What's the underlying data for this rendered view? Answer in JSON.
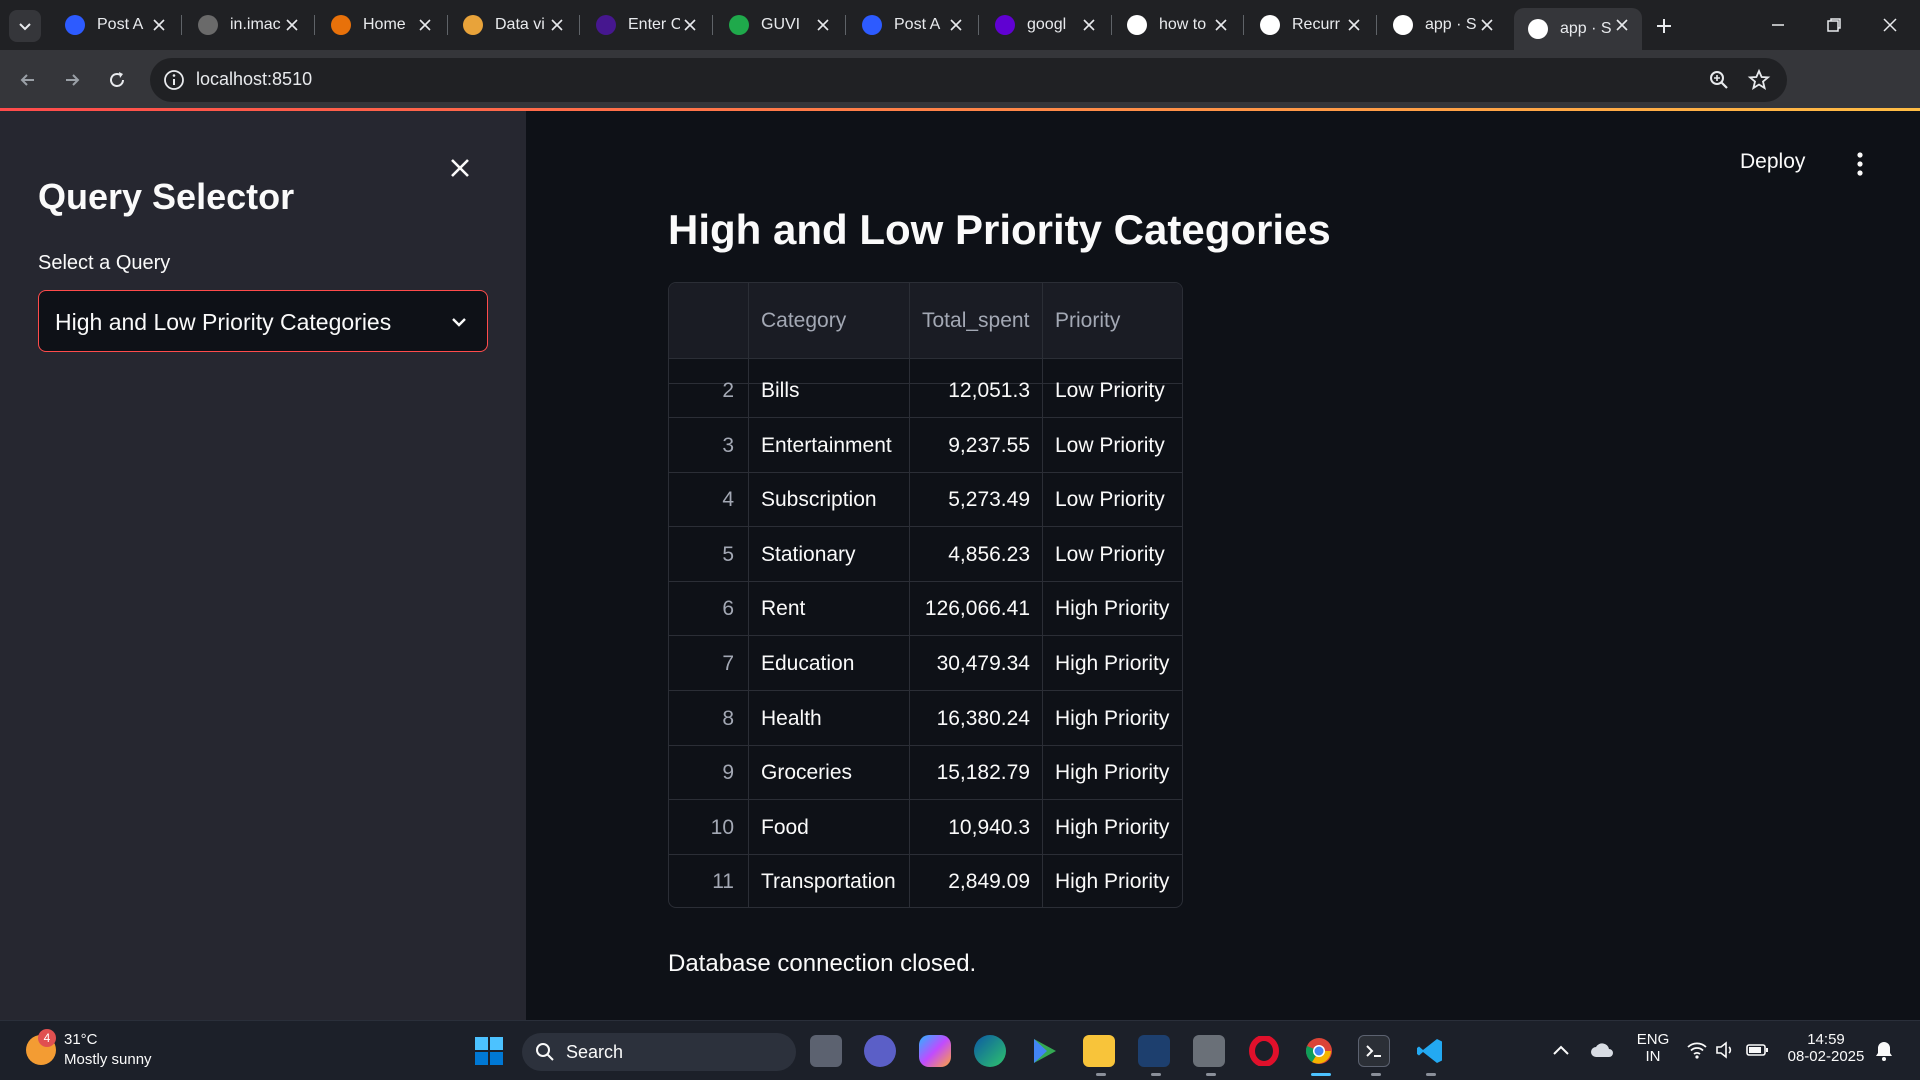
{
  "browser": {
    "tabs": [
      {
        "label": "Post A",
        "icon": "zoom-icon",
        "color": "#2d5bff"
      },
      {
        "label": "in.imac",
        "icon": "yahoo-images-icon",
        "color": "#6a6a6a"
      },
      {
        "label": "Home",
        "icon": "home-loader-icon",
        "color": "#e8710a"
      },
      {
        "label": "Data vi",
        "icon": "notebook-icon",
        "color": "#e8a33a"
      },
      {
        "label": "Enter C",
        "icon": "kahoot-icon",
        "color": "#46178f"
      },
      {
        "label": "GUVI",
        "icon": "guvi-icon",
        "color": "#1fa94b"
      },
      {
        "label": "Post A",
        "icon": "zoom-icon",
        "color": "#2d5bff"
      },
      {
        "label": "googl",
        "icon": "yahoo-icon",
        "color": "#6001d2"
      },
      {
        "label": "how to",
        "icon": "google-icon",
        "color": "#ffffff"
      },
      {
        "label": "Recurr",
        "icon": "chatgpt-icon",
        "color": "#ffffff"
      },
      {
        "label": "app · S",
        "icon": "streamlit-icon",
        "color": "#ffffff"
      },
      {
        "label": "app · S",
        "icon": "streamlit-icon",
        "color": "#ffffff"
      }
    ],
    "url": "localhost:8510"
  },
  "sidebar": {
    "title": "Query Selector",
    "select_label": "Select a Query",
    "selected_query": "High and Low Priority Categories"
  },
  "header": {
    "deploy_label": "Deploy"
  },
  "main": {
    "title": "High and Low Priority Categories",
    "table": {
      "columns": [
        "",
        "Category",
        "Total_spent",
        "Priority"
      ],
      "rows": [
        {
          "idx": "2",
          "category": "Bills",
          "total": "12,051.3",
          "priority": "Low Priority"
        },
        {
          "idx": "3",
          "category": "Entertainment",
          "total": "9,237.55",
          "priority": "Low Priority"
        },
        {
          "idx": "4",
          "category": "Subscription",
          "total": "5,273.49",
          "priority": "Low Priority"
        },
        {
          "idx": "5",
          "category": "Stationary",
          "total": "4,856.23",
          "priority": "Low Priority"
        },
        {
          "idx": "6",
          "category": "Rent",
          "total": "126,066.41",
          "priority": "High Priority"
        },
        {
          "idx": "7",
          "category": "Education",
          "total": "30,479.34",
          "priority": "High Priority"
        },
        {
          "idx": "8",
          "category": "Health",
          "total": "16,380.24",
          "priority": "High Priority"
        },
        {
          "idx": "9",
          "category": "Groceries",
          "total": "15,182.79",
          "priority": "High Priority"
        },
        {
          "idx": "10",
          "category": "Food",
          "total": "10,940.3",
          "priority": "High Priority"
        },
        {
          "idx": "11",
          "category": "Transportation",
          "total": "2,849.09",
          "priority": "High Priority"
        }
      ]
    },
    "footer_text": "Database connection closed."
  },
  "taskbar": {
    "weather_badge": "4",
    "temperature": "31°C",
    "condition": "Mostly sunny",
    "search_label": "Search",
    "lang_top": "ENG",
    "lang_bottom": "IN",
    "time": "14:59",
    "date": "08-02-2025"
  }
}
